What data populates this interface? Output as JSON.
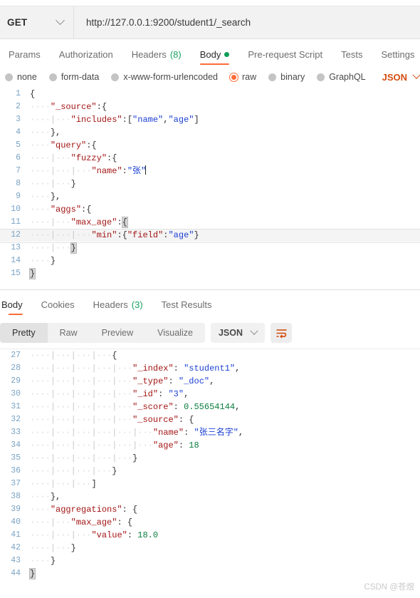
{
  "request": {
    "method": "GET",
    "url": "http://127.0.0.1:9200/student1/_search",
    "tabs": [
      {
        "label": "Params",
        "badge": "",
        "active": false
      },
      {
        "label": "Authorization",
        "badge": "",
        "active": false
      },
      {
        "label": "Headers",
        "badge": "(8)",
        "active": false
      },
      {
        "label": "Body",
        "badge": "",
        "active": true
      },
      {
        "label": "Pre-request Script",
        "badge": "",
        "active": false
      },
      {
        "label": "Tests",
        "badge": "",
        "active": false
      },
      {
        "label": "Settings",
        "badge": "",
        "active": false
      }
    ],
    "body_types": [
      {
        "label": "none",
        "selected": false
      },
      {
        "label": "form-data",
        "selected": false
      },
      {
        "label": "x-www-form-urlencoded",
        "selected": false
      },
      {
        "label": "raw",
        "selected": true
      },
      {
        "label": "binary",
        "selected": false
      },
      {
        "label": "GraphQL",
        "selected": false
      }
    ],
    "raw_format": "JSON",
    "body_text": "{\n    \"_source\":{\n        \"includes\":[\"name\",\"age\"]\n    },\n    \"query\":{\n        \"fuzzy\":{\n            \"name\":\"张\"\n        }\n    },\n    \"aggs\":{\n        \"max_age\":{\n            \"min\":{\"field\":\"age\"}\n        }\n    }\n}",
    "body_lines": [
      {
        "n": "1",
        "text": "{"
      },
      {
        "n": "2",
        "text": "    \"_source\":{"
      },
      {
        "n": "3",
        "text": "        \"includes\":[\"name\",\"age\"]"
      },
      {
        "n": "4",
        "text": "    },"
      },
      {
        "n": "5",
        "text": "    \"query\":{"
      },
      {
        "n": "6",
        "text": "        \"fuzzy\":{"
      },
      {
        "n": "7",
        "text": "            \"name\":\"张\""
      },
      {
        "n": "8",
        "text": "        }"
      },
      {
        "n": "9",
        "text": "    },"
      },
      {
        "n": "10",
        "text": "    \"aggs\":{"
      },
      {
        "n": "11",
        "text": "        \"max_age\":{"
      },
      {
        "n": "12",
        "text": "            \"min\":{\"field\":\"age\"}"
      },
      {
        "n": "13",
        "text": "        }"
      },
      {
        "n": "14",
        "text": "    }"
      },
      {
        "n": "15",
        "text": "}"
      }
    ]
  },
  "response": {
    "tabs": [
      {
        "label": "Body",
        "badge": "",
        "active": true
      },
      {
        "label": "Cookies",
        "badge": "",
        "active": false
      },
      {
        "label": "Headers",
        "badge": "(3)",
        "active": false
      },
      {
        "label": "Test Results",
        "badge": "",
        "active": false
      }
    ],
    "view_modes": [
      {
        "label": "Pretty",
        "active": true
      },
      {
        "label": "Raw",
        "active": false
      },
      {
        "label": "Preview",
        "active": false
      },
      {
        "label": "Visualize",
        "active": false
      }
    ],
    "format": "JSON",
    "wrap_icon": "word-wrap-icon",
    "body_lines": [
      {
        "n": "27",
        "text": "                {"
      },
      {
        "n": "28",
        "text": "                    \"_index\": \"student1\","
      },
      {
        "n": "29",
        "text": "                    \"_type\": \"_doc\","
      },
      {
        "n": "30",
        "text": "                    \"_id\": \"3\","
      },
      {
        "n": "31",
        "text": "                    \"_score\": 0.55654144,"
      },
      {
        "n": "32",
        "text": "                    \"_source\": {"
      },
      {
        "n": "33",
        "text": "                        \"name\": \"张三名字\","
      },
      {
        "n": "34",
        "text": "                        \"age\": 18"
      },
      {
        "n": "35",
        "text": "                    }"
      },
      {
        "n": "36",
        "text": "                }"
      },
      {
        "n": "37",
        "text": "            ]"
      },
      {
        "n": "38",
        "text": "    },"
      },
      {
        "n": "39",
        "text": "    \"aggregations\": {"
      },
      {
        "n": "40",
        "text": "        \"max_age\": {"
      },
      {
        "n": "41",
        "text": "            \"value\": 18.0"
      },
      {
        "n": "42",
        "text": "        }"
      },
      {
        "n": "43",
        "text": "    }"
      },
      {
        "n": "44",
        "text": "}"
      }
    ],
    "values": {
      "_index": "student1",
      "_type": "_doc",
      "_id": "3",
      "_score": "0.55654144",
      "name": "张三名字",
      "age": "18",
      "max_age_value": "18.0"
    }
  },
  "watermark": "CSDN @苍煜",
  "colors": {
    "accent": "#ff6c37",
    "accent_dark": "#d44d10",
    "green": "#1aa260",
    "key": "#a31515",
    "string": "#1a3fd4",
    "number": "#0a7d3e",
    "linenum": "#7aa3c4"
  }
}
